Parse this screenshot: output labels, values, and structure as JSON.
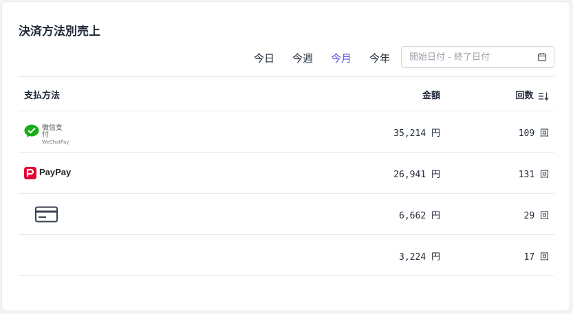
{
  "card": {
    "title": "決済方法別売上"
  },
  "period_tabs": [
    {
      "label": "今日",
      "active": false
    },
    {
      "label": "今週",
      "active": false
    },
    {
      "label": "今月",
      "active": true
    },
    {
      "label": "今年",
      "active": false
    }
  ],
  "date_range": {
    "value": "",
    "placeholder": "開始日付 - 終了日付",
    "icon": "calendar-icon"
  },
  "table": {
    "columns": {
      "method": "支払方法",
      "amount": "金額",
      "count": "回数",
      "count_sort_icon": "sort-descending-icon"
    },
    "rows": [
      {
        "method_icon": "wechat-pay-logo",
        "method_text_cn": "微信支付",
        "method_text_en": "WeChatPay",
        "amount": "35,214 円",
        "count": "109 回"
      },
      {
        "method_icon": "paypay-logo",
        "method_text": "PayPay",
        "amount": "26,941 円",
        "count": "131 回"
      },
      {
        "method_icon": "credit-card-icon",
        "amount": "6,662 円",
        "count": "29 回"
      },
      {
        "method_icon": "",
        "amount": "3,224 円",
        "count": "17 回"
      }
    ]
  },
  "colors": {
    "accent": "#5b4fe0",
    "wechat_green": "#1aad19",
    "paypay_red": "#e60033",
    "border": "#e5e7eb"
  }
}
